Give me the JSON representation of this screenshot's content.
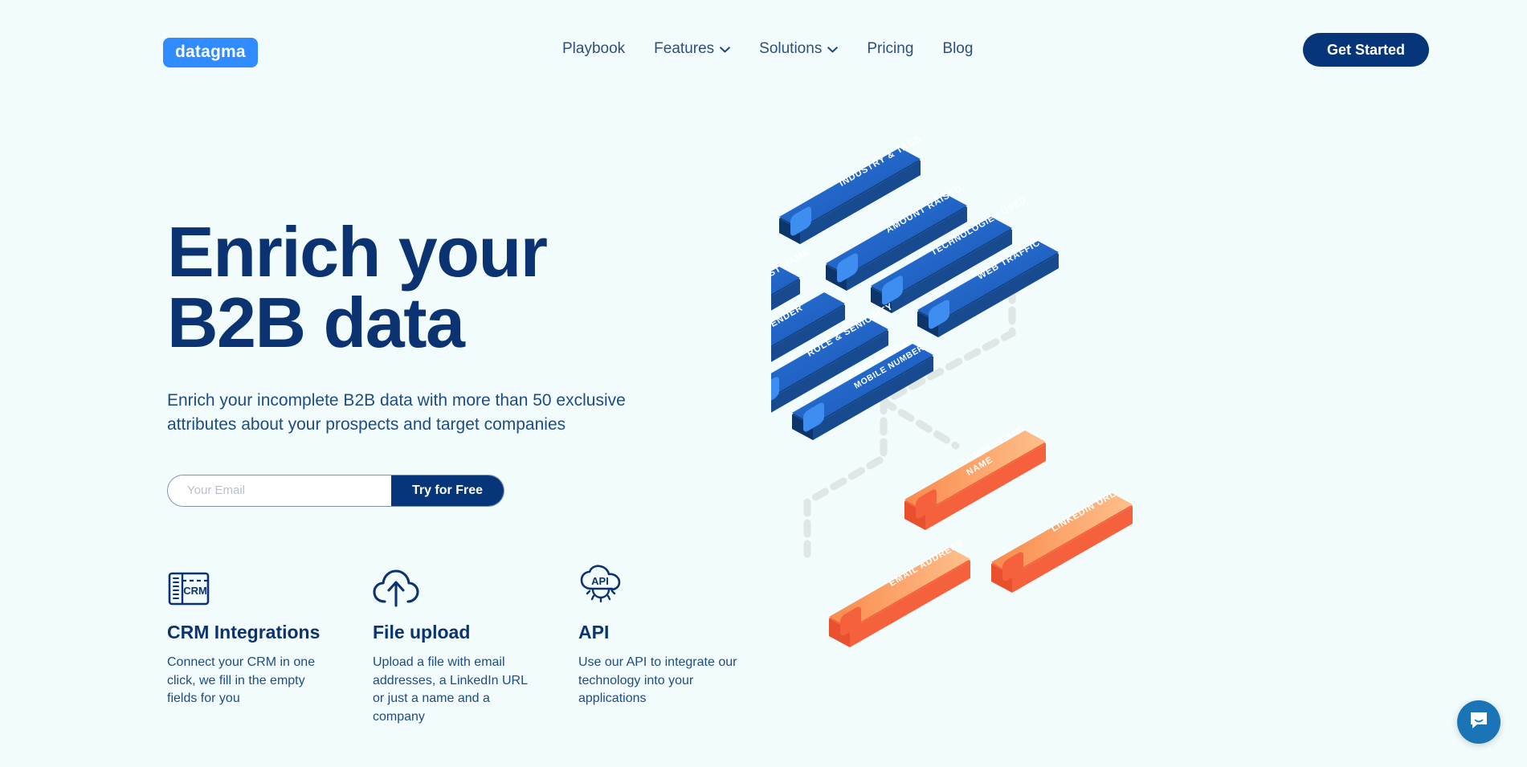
{
  "header": {
    "logo_text": "datagma",
    "nav": [
      {
        "label": "Playbook",
        "has_dropdown": false
      },
      {
        "label": "Features",
        "has_dropdown": true
      },
      {
        "label": "Solutions",
        "has_dropdown": true
      },
      {
        "label": "Pricing",
        "has_dropdown": false
      },
      {
        "label": "Blog",
        "has_dropdown": false
      }
    ],
    "cta_label": "Get Started"
  },
  "hero": {
    "title": "Enrich your\nB2B data",
    "subtitle": "Enrich your incomplete B2B data with more than 50 exclusive\nattributes about your prospects and target companies",
    "email_placeholder": "Your Email",
    "email_value": "",
    "submit_label": "Try for Free"
  },
  "features": [
    {
      "icon": "crm-icon",
      "title": "CRM Integrations",
      "desc": "Connect your CRM in one click, we fill in the empty fields for you"
    },
    {
      "icon": "cloud-upload-icon",
      "title": "File upload",
      "desc": "Upload a file with email addresses, a LinkedIn URL or just a name and a company"
    },
    {
      "icon": "api-cloud-gear-icon",
      "title": "API",
      "desc": "Use our API to integrate our technology into your applications"
    }
  ],
  "illustration": {
    "blue_cards": [
      {
        "label": "INDUSTRY & TAGS",
        "icon": "grid-icon"
      },
      {
        "label": "AMOUNT RAISED",
        "icon": "dollar-icon"
      },
      {
        "label": "TECHNOLOGIES USED",
        "icon": "monitor-icon"
      },
      {
        "label": "WEB TRAFFIC",
        "icon": "growth-icon"
      },
      {
        "label": "FIRST & LAST NAME",
        "icon": "id-icon"
      },
      {
        "label": "GENDER",
        "icon": "gender-icon"
      },
      {
        "label": "ROLE & SENIORITY",
        "icon": "badge-icon"
      },
      {
        "label": "PROFESSIONAL MOBILE NUMBER",
        "icon": "phone-icon"
      }
    ],
    "orange_cards": [
      {
        "label": "COMPANY AND NAME",
        "icon": "building-icon"
      },
      {
        "label": "LINKEDIN URL",
        "icon": "linkedin-icon"
      },
      {
        "label": "EMAIL ADDRESS",
        "icon": "envelope-icon"
      }
    ]
  },
  "chat": {
    "icon": "chat-bubble-icon"
  },
  "colors": {
    "page_bg": "#f2fcfc",
    "brand_blue": "#2f8bff",
    "navy": "#06357a",
    "heading_navy": "#0b3271",
    "nav_text": "#2d4f78",
    "card_blue": "#1f63c4",
    "card_orange": "#f98b4e",
    "chat_blue": "#1a74b5"
  }
}
